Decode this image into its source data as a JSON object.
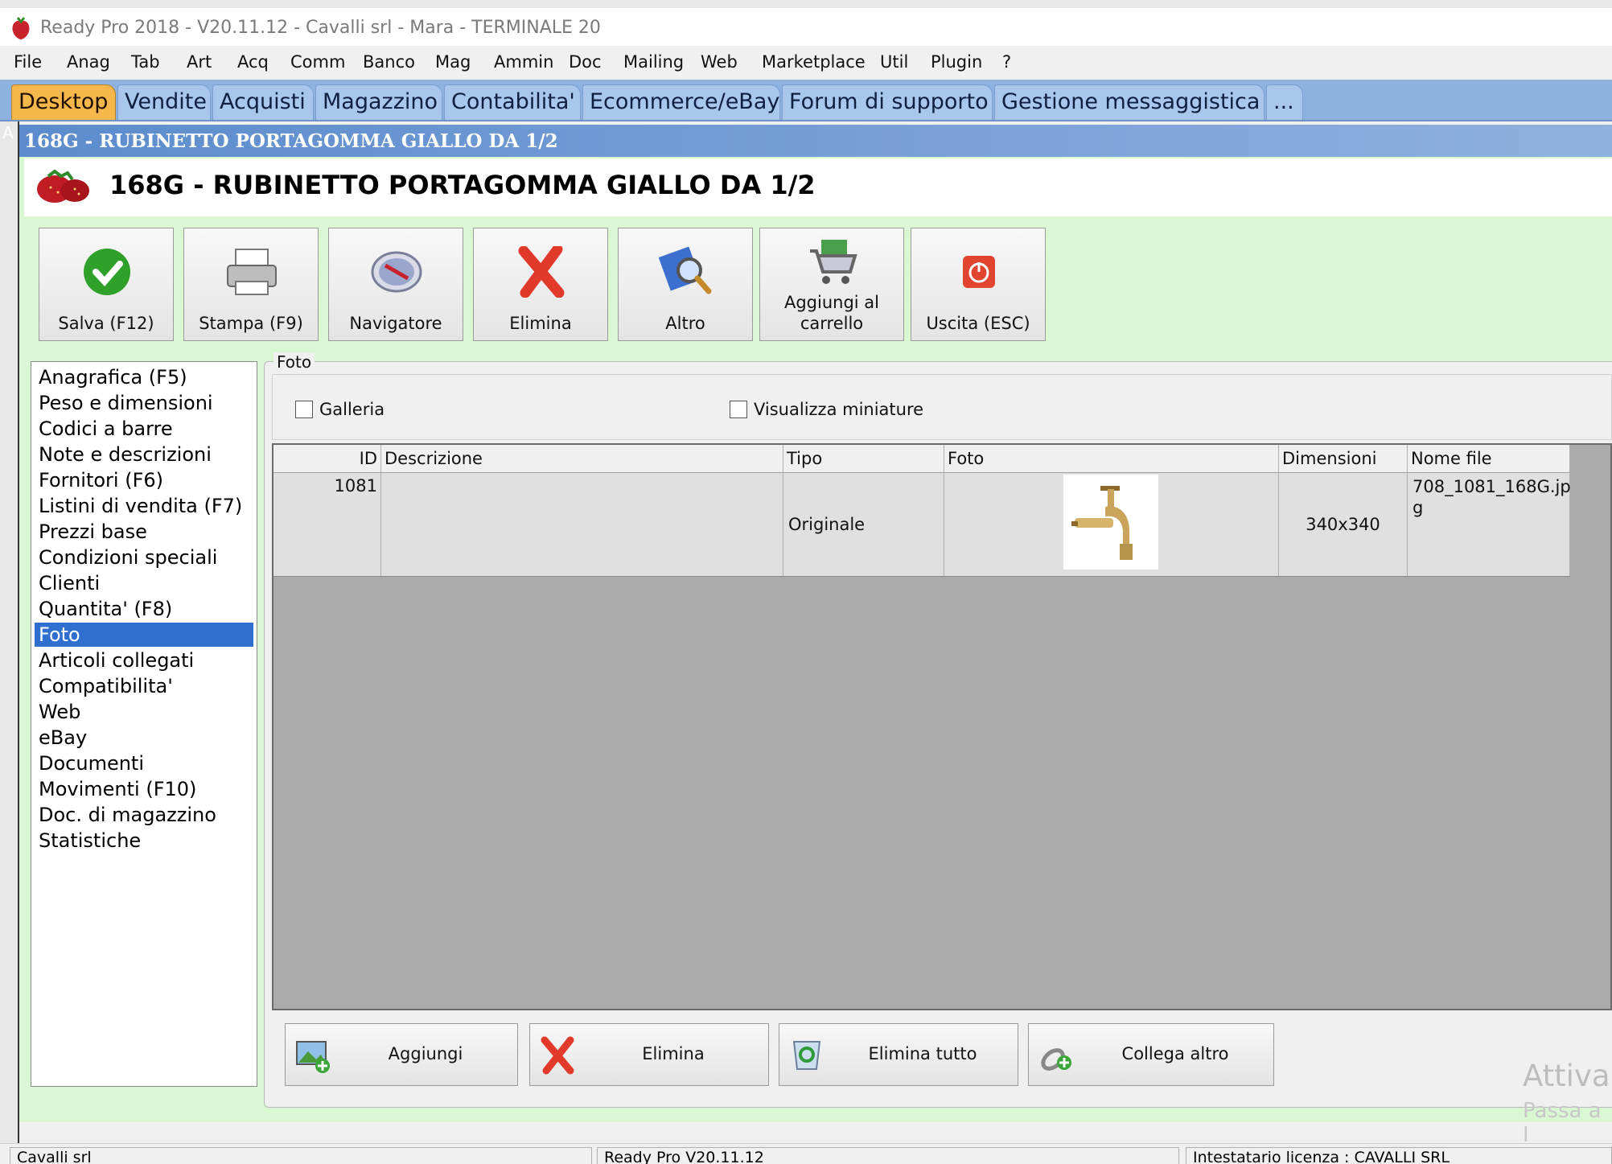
{
  "window_title": "Ready Pro 2018 - V20.11.12 - Cavalli srl - Mara - TERMINALE 20",
  "menu": [
    "File",
    "Anag",
    "Tab",
    "Art",
    "Acq",
    "Comm",
    "Banco",
    "Mag",
    "Ammin",
    "Doc",
    "Mailing",
    "Web",
    "Marketplace",
    "Util",
    "Plugin",
    "?"
  ],
  "tabs": [
    {
      "label": "Desktop",
      "active": true
    },
    {
      "label": "Vendite"
    },
    {
      "label": "Acquisti"
    },
    {
      "label": "Magazzino"
    },
    {
      "label": "Contabilita'"
    },
    {
      "label": "Ecommerce/eBay"
    },
    {
      "label": "Forum di supporto"
    },
    {
      "label": "Gestione messaggistica"
    },
    {
      "label": "..."
    }
  ],
  "side_strip_label": "A",
  "child_window_title": "168G - RUBINETTO PORTAGOMMA GIALLO DA 1/2",
  "header_title": "168G - RUBINETTO PORTAGOMMA GIALLO DA 1/2",
  "toolbar": {
    "save": "Salva (F12)",
    "print": "Stampa (F9)",
    "navigator": "Navigatore",
    "delete": "Elimina",
    "other": "Altro",
    "cart_line1": "Aggiungi al",
    "cart_line2": "carrello",
    "exit": "Uscita (ESC)"
  },
  "nav_items": [
    "Anagrafica (F5)",
    "Peso e dimensioni",
    "Codici a barre",
    "Note e descrizioni",
    "Fornitori (F6)",
    "Listini di vendita (F7)",
    "Prezzi base",
    "Condizioni speciali",
    "Clienti",
    "Quantita' (F8)",
    "Foto",
    "Articoli collegati",
    "Compatibilita'",
    "Web",
    "eBay",
    "Documenti",
    "Movimenti (F10)",
    "Doc. di magazzino",
    "Statistiche"
  ],
  "nav_selected": "Foto",
  "group_label": "Foto",
  "checkboxes": {
    "gallery": "Galleria",
    "thumbnails": "Visualizza miniature"
  },
  "grid": {
    "columns": [
      "ID",
      "Descrizione",
      "Tipo",
      "Foto",
      "Dimensioni",
      "Nome file"
    ],
    "row": {
      "id": "1081",
      "descrizione": "",
      "tipo": "Originale",
      "dimensioni": "340x340",
      "nome_file_1": "708_1081_168G.jp",
      "nome_file_2": "g"
    }
  },
  "bottom_buttons": {
    "add": "Aggiungi",
    "delete": "Elimina",
    "delete_all": "Elimina tutto",
    "link_other": "Collega altro"
  },
  "watermark": {
    "line1": "Attiva",
    "line2": "Passa a I"
  },
  "statusbar": {
    "company": "Cavalli srl",
    "version": "Ready Pro V20.11.12",
    "license": "Intestatario licenza : CAVALLI SRL"
  },
  "colors": {
    "tab_active": "#f6b84d",
    "tabbar": "#8eb2e0",
    "content_bg": "#d9f7d2",
    "selection": "#2f6fd0",
    "title_gradient": "#5c8ccd"
  }
}
